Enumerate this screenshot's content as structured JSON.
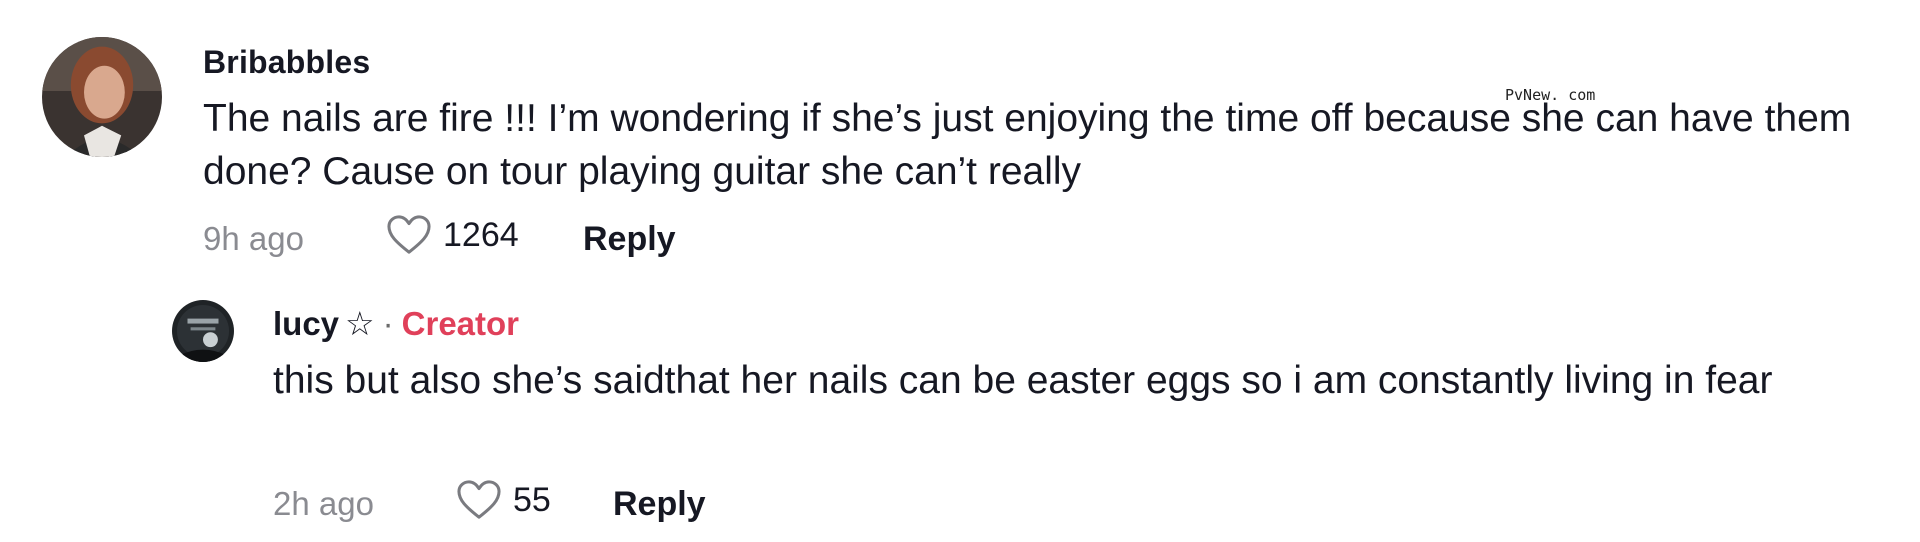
{
  "watermark": "PvNew. com",
  "comments": [
    {
      "username": "Bribabbles",
      "text": "The nails are fire !!! I’m wondering if she’s just enjoying the time off because she can have them done? Cause on tour playing guitar she can’t really",
      "time": "9h ago",
      "likes": "1264",
      "reply_label": "Reply",
      "avatar_icon": "user-avatar-photo"
    }
  ],
  "replies": [
    {
      "username": "lucy",
      "star": "☆",
      "separator": "·",
      "badge": "Creator",
      "badge_color": "#e0405a",
      "text": "this but also she’s saidthat her nails can be easter eggs so i am constantly living in fear",
      "time": "2h ago",
      "likes": "55",
      "reply_label": "Reply",
      "avatar_icon": "user-avatar-photo"
    }
  ],
  "icons": {
    "like": "heart-outline-icon"
  }
}
